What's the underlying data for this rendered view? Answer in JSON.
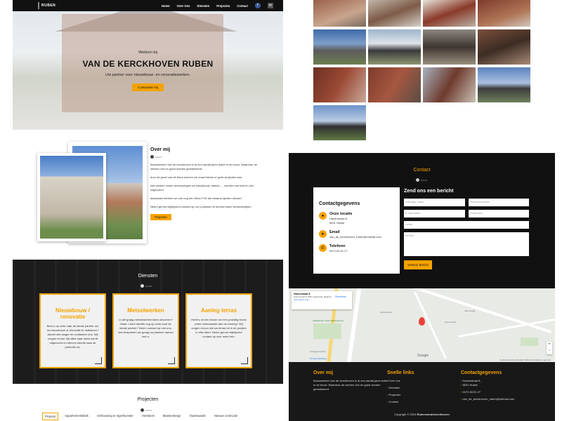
{
  "header": {
    "logo_text": "RUBEN",
    "nav": [
      "Home",
      "Over Ons",
      "Diensten",
      "Projecten",
      "Contact"
    ],
    "social_icons": [
      "facebook-icon",
      "mail-icon"
    ]
  },
  "hero": {
    "welcome": "Welkom bij",
    "title": "VAN DE KERCKHOVEN RUBEN",
    "subtitle": "Uw partner voor nieuwbouw- en renovatiewerken.",
    "button": "Contacteer mij"
  },
  "about": {
    "title": "Over mij",
    "divider_dots": "•••••",
    "paragraphs": [
      "Bouwwerken Van de kerckhoven is al een aantal jaren actief in de bouw. Waardoor de werken vlot en goed worden gerealiseerd.",
      "door de groei van de firma kunnen we zowel kleine of grote projecten aan.",
      "Alle werken zowel verbouwingen tot nieuwbouw, steeds ,... worden met hart en ziel uitgevoerd.",
      "daarnaast hebben we ook nog een firma TUS die totaal projecten uitvoert.",
      "Neem gerust vrijblijvend contact op om u plannen te kunnen laten verwezenlijken."
    ],
    "button": "Projecten"
  },
  "services": {
    "title": "Diensten",
    "divider_dots": "•••••",
    "cards": [
      {
        "title": "Nieuwbouw / renovatie",
        "text": "Bent u op zoek naar de ideale partner om uw nieuwbouw of renovatie te realiseren? Aarzel niet langer en contacteer ons. Wij zorgen ervoor dat alles naar wens wordt uitgevoerd en streven steeds naar de perfectie na."
      },
      {
        "title": "Metselwerken",
        "text": "U wilt graag metselwerken laten uitvoeren? Maar u bent slechts nog op zoek naar de ideale partner? Neem contact op met ons, dan bespreken we graag uw plannen samen met u."
      },
      {
        "title": "Aanleg terras",
        "text": "Heeft u al een droom om een prachtig terras peen meerwaarde aan de woning? Wij zorgen ervoor dat uw terras tot in de puntjes in elke sfeer. Neem gerust vrijblijvend contact op voor meer info."
      }
    ]
  },
  "projects": {
    "title": "Projecten",
    "divider_dots": "•••••",
    "tabs": [
      "Projects",
      "Appartementsblok",
      "Verbouwing te Ingelmunster",
      "Hombeek",
      "Blankenberge",
      "Oudenaarde",
      "Nieuwe contructie"
    ]
  },
  "contact": {
    "title": "Contact",
    "divider_dots": "•••••",
    "info_title": "Contactgegevens",
    "location_label": "Onze locatie",
    "address_line1": "Hazenstraat 8,",
    "address_line2": "8531 Hulste",
    "email_label": "Email",
    "email": "van_de_kerckhoven_ruben@hotmail.com",
    "phone_label": "Telefoon",
    "phone": "0472 83 51 27",
    "form_title": "Zend ons een bericht",
    "fields": {
      "name": "Volledige naam",
      "phone": "Telefoonnummer",
      "email": "E-mail adres",
      "subject": "Onderwerp",
      "company": "Adres",
      "message": "Bericht"
    },
    "submit": "Verstuur Bericht"
  },
  "map": {
    "place": "Hazenstraat 8",
    "address": "Hazenstraat 8, 8531 Harelbeke, Belgium",
    "directions": "Directions",
    "larger_map": "View larger map",
    "google": "Google",
    "footer_note": "Keyboard shortcuts   Map data ©2024   Terms   Report a map error",
    "labels": [
      "Kasteelstraat",
      "Hazenstraat",
      "Vaurustraat",
      "Volwasenen onder Racing Arena",
      "Stringlaan Hulste",
      "W Goed afsluiting"
    ]
  },
  "footer": {
    "about_title": "Over mij",
    "about_text": "Bouwwerken Van de kerckhoven is al een aantal jaren actief in de bouw. Waardoor de werken vlot en goed worden gerealiseerd.",
    "links_title": "Snelle links",
    "links": [
      "Over ons",
      "Diensten",
      "Projecten",
      "Contact"
    ],
    "contact_title": "Contactgegevens",
    "address_line1": "Hazenstraat 8,",
    "address_line2": "8531 Hulste",
    "phone": "0472 83 51 27",
    "email": "van_de_kerckhoven_ruben@hotmail.com",
    "copyright_prefix": "Copyright © 2024 ",
    "copyright_brand": "Rubenvandekerckhoven"
  },
  "colors": {
    "accent": "#f5a300",
    "dark": "#111111"
  }
}
